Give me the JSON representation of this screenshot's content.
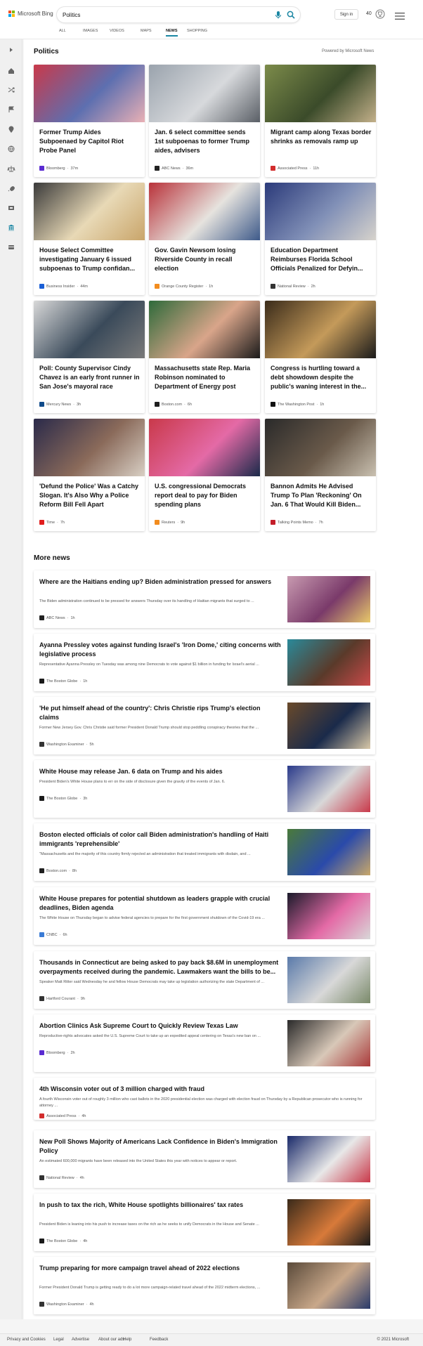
{
  "header": {
    "logo_text": "Microsoft Bing",
    "search_value": "Politics",
    "signin_label": "Sign in",
    "points": "40",
    "tabs": [
      {
        "label": "ALL",
        "active": false
      },
      {
        "label": "IMAGES",
        "active": false
      },
      {
        "label": "VIDEOS",
        "active": false
      },
      {
        "label": "MAPS",
        "active": false
      },
      {
        "label": "NEWS",
        "active": true
      },
      {
        "label": "SHOPPING",
        "active": false
      }
    ]
  },
  "sidebar": {
    "icons": [
      "expand-icon",
      "home-icon",
      "shuffle-icon",
      "flag-icon",
      "location-pin-icon",
      "globe-icon",
      "scale-icon",
      "rocket-icon",
      "film-icon",
      "bank-icon",
      "card-icon"
    ]
  },
  "politics": {
    "title": "Politics",
    "powered_by": "Powered by Microsoft News",
    "cards": [
      {
        "title": "Former Trump Aides Subpoenaed by Capitol Riot Probe Panel",
        "source": "Bloomberg",
        "time": "37m",
        "logo_color": "#5a2bd1",
        "img_colors": [
          "#c9394a",
          "#5d6fb0",
          "#e9b0b5"
        ]
      },
      {
        "title": "Jan. 6 select committee sends 1st subpoenas to former Trump aides, advisers",
        "source": "ABC News",
        "time": "36m",
        "logo_color": "#222222",
        "img_colors": [
          "#9aa3ad",
          "#d7d9dc",
          "#5a5f66"
        ]
      },
      {
        "title": "Migrant camp along Texas border shrinks as removals ramp up",
        "source": "Associated Press",
        "time": "11h",
        "logo_color": "#d22d2d",
        "img_colors": [
          "#7c8b4a",
          "#3b4b2a",
          "#c3b08a"
        ]
      },
      {
        "title": "House Select Committee investigating January 6 issued subpoenas to Trump confidan...",
        "source": "Business Insider",
        "time": "44m",
        "logo_color": "#1a5fd6",
        "img_colors": [
          "#3a3a3a",
          "#e8d9b6",
          "#c9a56a"
        ]
      },
      {
        "title": "Gov. Gavin Newsom losing Riverside County in recall election",
        "source": "Orange County Register",
        "time": "1h",
        "logo_color": "#f28c1e",
        "img_colors": [
          "#b9323a",
          "#e6e3de",
          "#3e5a8a"
        ]
      },
      {
        "title": "Education Department Reimburses Florida School Officials Penalized for Defyin...",
        "source": "National Review",
        "time": "2h",
        "logo_color": "#333333",
        "img_colors": [
          "#2b3a7a",
          "#8190b7",
          "#d7d3cc"
        ]
      },
      {
        "title": "Poll: County Supervisor Cindy Chavez is an early front runner in San Jose's mayoral race",
        "source": "Mercury News",
        "time": "3h",
        "logo_color": "#0f4a8a",
        "img_colors": [
          "#d8d8d8",
          "#3a4a5a",
          "#7a7a7a"
        ]
      },
      {
        "title": "Massachusetts state Rep. Maria Robinson nominated to Department of Energy post",
        "source": "Boston.com",
        "time": "6h",
        "logo_color": "#1f1f1f",
        "img_colors": [
          "#2e6a3a",
          "#d9a58a",
          "#1a1a1a"
        ]
      },
      {
        "title": "Congress is hurtling toward a debt showdown despite the public's waning interest in the...",
        "source": "The Washington Post",
        "time": "1h",
        "logo_color": "#111111",
        "img_colors": [
          "#3a2b1a",
          "#c49a5a",
          "#1a1a1a"
        ]
      },
      {
        "title": "'Defund the Police' Was a Catchy Slogan. It's Also Why a Police Reform Bill Fell Apart",
        "source": "Time",
        "time": "7h",
        "logo_color": "#e11d1d",
        "img_colors": [
          "#2a2a4a",
          "#8a6a5a",
          "#d8cfc4"
        ]
      },
      {
        "title": "U.S. congressional Democrats report deal to pay for Biden spending plans",
        "source": "Reuters",
        "time": "9h",
        "logo_color": "#f28c1e",
        "img_colors": [
          "#c9394a",
          "#e46aa6",
          "#1a2a4a"
        ]
      },
      {
        "title": "Bannon Admits He Advised Trump To Plan 'Reckoning' On Jan. 6 That Would Kill Biden...",
        "source": "Talking Points Memo",
        "time": "7h",
        "logo_color": "#c41e2a",
        "img_colors": [
          "#2a2a2a",
          "#6a5a4a",
          "#c9c0b0"
        ]
      }
    ]
  },
  "more_news": {
    "title": "More news",
    "items": [
      {
        "title": "Where are the Haitians ending up? Biden administration pressed for answers",
        "desc": "The Biden administration continued to be pressed for answers Thursday over its handling of Haitian migrants that surged to ...",
        "source": "ABC News",
        "time": "1h",
        "logo_color": "#222222",
        "img_colors": [
          "#c89ab0",
          "#7a3a6a",
          "#e8c96a"
        ]
      },
      {
        "title": "Ayanna Pressley votes against funding Israel's 'Iron Dome,' citing concerns with legislative process",
        "desc": "Representative Ayanna Pressley on Tuesday was among nine Democrats to vote against $1 billion in funding for Israel's aerial ...",
        "source": "The Boston Globe",
        "time": "1h",
        "logo_color": "#1a1a1a",
        "img_colors": [
          "#2a8a9a",
          "#5a3a2a",
          "#c94a4a"
        ]
      },
      {
        "title": "'He put himself ahead of the country': Chris Christie rips Trump's election claims",
        "desc": "Former New Jersey Gov. Chris Christie said former President Donald Trump should stop peddling conspiracy theories that the ...",
        "source": "Washington Examiner",
        "time": "5h",
        "logo_color": "#333333",
        "img_colors": [
          "#6a4a2a",
          "#1a2a4a",
          "#d8c8a8"
        ]
      },
      {
        "title": "White House may release Jan. 6 data on Trump and his aides",
        "desc": "President Biden's White House plans to err on the side of disclosure given the gravity of the events of Jan. 6.",
        "source": "The Boston Globe",
        "time": "3h",
        "logo_color": "#1a1a1a",
        "img_colors": [
          "#2a3a8a",
          "#d8d8d8",
          "#c9394a"
        ]
      },
      {
        "title": "Boston elected officials of color call Biden administration's handling of Haiti immigrants 'reprehensible'",
        "desc": "\"Massachusetts and the majority of this country firmly rejected an administration that treated immigrants with disdain, and ...",
        "source": "Boston.com",
        "time": "8h",
        "logo_color": "#1f1f1f",
        "img_colors": [
          "#4a7a3a",
          "#2a4aaa",
          "#c9a86a"
        ]
      },
      {
        "title": "White House prepares for potential shutdown as leaders grapple with crucial deadlines, Biden agenda",
        "desc": "The White House on Thursday began to advise federal agencies to prepare for the first government shutdown of the Covid-19 era ...",
        "source": "CNBC",
        "time": "6h",
        "logo_color": "#3a7bd5",
        "img_colors": [
          "#1a1a2a",
          "#e46aa6",
          "#d8d8d8"
        ]
      },
      {
        "title": "Thousands in Connecticut are being asked to pay back $8.6M in unemployment overpayments received during the pandemic. Lawmakers want the bills to be...",
        "desc": "Speaker Matt Ritter said Wednesday he and fellow House Democrats may take up legislation authorizing the state Department of ...",
        "source": "Hartford Courant",
        "time": "9h",
        "logo_color": "#333333",
        "img_colors": [
          "#5a7aaa",
          "#d8d8d8",
          "#7a8a6a"
        ]
      },
      {
        "title": "Abortion Clinics Ask Supreme Court to Quickly Review Texas Law",
        "desc": "Reproductive-rights advocates asked the U.S. Supreme Court to take up an expedited appeal centering on Texas's new ban on ...",
        "source": "Bloomberg",
        "time": "2h",
        "logo_color": "#5a2bd1",
        "img_colors": [
          "#2a2a2a",
          "#d8c8b8",
          "#aa3a3a"
        ]
      },
      {
        "title": "4th Wisconsin voter out of 3 million charged with fraud",
        "desc": "A fourth Wisconsin voter out of roughly 3 million who cast ballots in the 2020 presidential election was charged with election fraud on Thursday by a Republican prosecutor who is running for attorney ...",
        "source": "Associated Press",
        "time": "4h",
        "logo_color": "#d22d2d",
        "img_colors": []
      },
      {
        "title": "New Poll Shows Majority of Americans Lack Confidence in Biden's Immigration Policy",
        "desc": "An estimated 600,000 migrants have been released into the United States this year with notices to appear or report.",
        "source": "National Review",
        "time": "4h",
        "logo_color": "#333333",
        "img_colors": [
          "#1a2a6a",
          "#e8e8e8",
          "#c9394a"
        ]
      },
      {
        "title": "In push to tax the rich, White House spotlights billionaires' tax rates",
        "desc": "President Biden is leaning into his push to increase taxes on the rich as he seeks to unify Democrats in the House and Senate ...",
        "source": "The Boston Globe",
        "time": "4h",
        "logo_color": "#1a1a1a",
        "img_colors": [
          "#3a2a1a",
          "#d87a3a",
          "#1a1a1a"
        ]
      },
      {
        "title": "Trump preparing for more campaign travel ahead of 2022 elections",
        "desc": "Former President Donald Trump is getting ready to do a lot more campaign-related travel ahead of the 2022 midterm elections, ...",
        "source": "Washington Examiner",
        "time": "4h",
        "logo_color": "#333333",
        "img_colors": [
          "#5a4a3a",
          "#c9a88a",
          "#2a3a6a"
        ]
      }
    ]
  },
  "footer": {
    "links": [
      "Privacy and Cookies",
      "Legal",
      "Advertise",
      "About our ads",
      "Help",
      "Feedback"
    ],
    "copyright": "© 2021 Microsoft"
  }
}
